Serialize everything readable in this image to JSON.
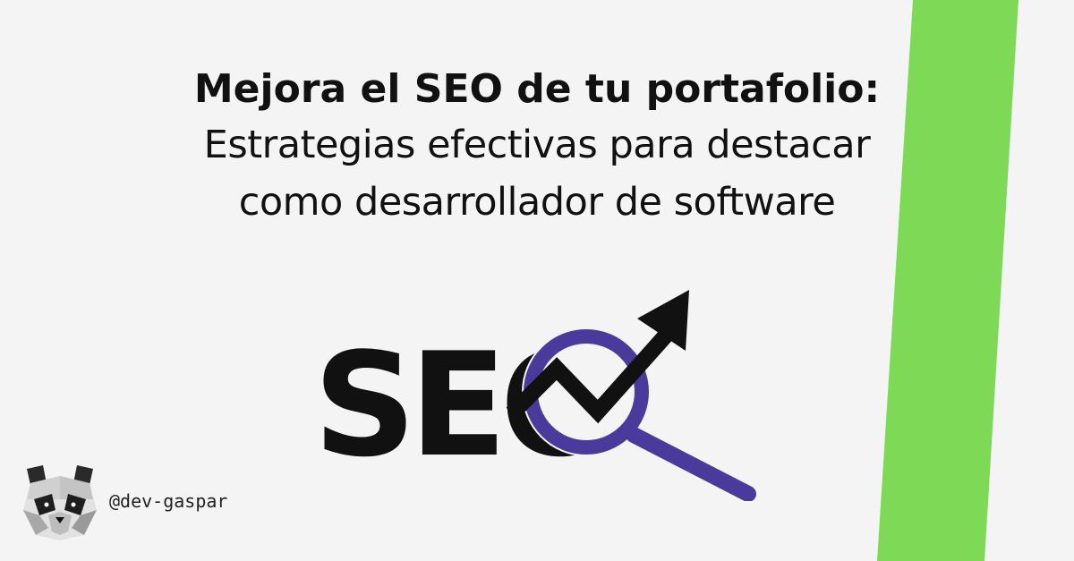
{
  "heading": {
    "line1": "Mejora el SEO de tu portafolio:",
    "line2": "Estrategias efectivas para destacar",
    "line3": "como desarrollador de software"
  },
  "logo": {
    "text": "SEO",
    "icon": "magnifier-trend-arrow-icon"
  },
  "author": {
    "handle": "@dev-gaspar",
    "avatar_icon": "panda-avatar-icon"
  },
  "colors": {
    "background": "#f4f4f4",
    "stripe": "#7ed957",
    "accent": "#4a3a9c",
    "text": "#111111"
  }
}
